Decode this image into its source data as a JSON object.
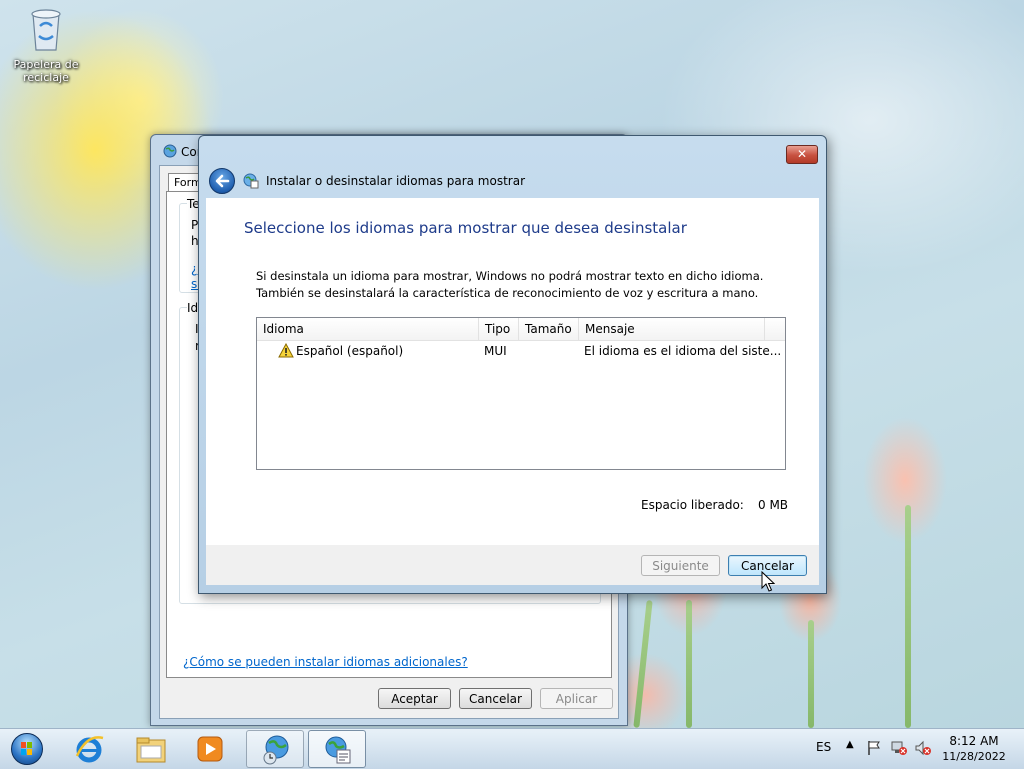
{
  "desktop": {
    "recycle_bin_label": "Papelera de reciclaje"
  },
  "back_window": {
    "title": "Cor",
    "tab_label": "Forma",
    "group1_caption": "Te",
    "group1_text_1": "Pa",
    "group1_text_2": "ha",
    "group1_link_1": "¿C",
    "group1_link_2": "se",
    "group2_caption": "Idi",
    "group2_text_1": "I",
    "group2_text_2": "r",
    "help_link": "¿Cómo se pueden instalar idiomas adicionales?",
    "ok_button": "Aceptar",
    "cancel_button": "Cancelar",
    "apply_button": "Aplicar"
  },
  "dialog": {
    "close_label": "✕",
    "nav_title": "Instalar o desinstalar idiomas para mostrar",
    "heading": "Seleccione los idiomas para mostrar que desea desinstalar",
    "description": "Si desinstala un idioma para mostrar, Windows no podrá mostrar texto en dicho idioma. También se desinstalará la característica de reconocimiento de voz y escritura a mano.",
    "table": {
      "columns": [
        "Idioma",
        "Tipo",
        "Tamaño",
        "Mensaje"
      ],
      "rows": [
        {
          "idioma": "Español (español)",
          "tipo": "MUI",
          "tamano": "",
          "mensaje": "El idioma es el idioma del siste...",
          "icon": "warning-icon"
        }
      ]
    },
    "space_label": "Espacio liberado:",
    "space_value": "0 MB",
    "next_button": "Siguiente",
    "cancel_button": "Cancelar"
  },
  "taskbar": {
    "language": "ES",
    "time": "8:12 AM",
    "date": "11/28/2022",
    "pinned": [
      "internet-explorer-icon",
      "windows-explorer-icon",
      "media-player-icon",
      "region-language-icon",
      "language-installer-icon"
    ]
  },
  "colors": {
    "heading_blue": "#1e3b8a",
    "link_blue": "#0066cc",
    "close_red": "#c75140"
  }
}
